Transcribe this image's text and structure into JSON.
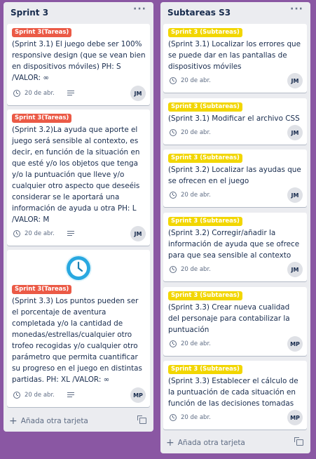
{
  "lists": [
    {
      "title": "Sprint 3",
      "menu": "···",
      "add_card": "Añada otra tarjeta",
      "cards": [
        {
          "label": "Sprint 3(Tareas)",
          "text": "(Sprint 3.1) El juego debe ser 100% responsive design (que se vean bien en dispositivos móviles) PH: S /VALOR: ∞",
          "date": "20 de abr.",
          "member": "JM"
        },
        {
          "label": "Sprint 3(Tareas)",
          "text": "(Sprint 3.2)La ayuda que aporte el juego será sensible al contexto, es decir, en función de la situación en que esté y/o los objetos que tenga y/o la puntuación que lleve y/o cualquier otro aspecto que deseéis considerar se le aportará una información de ayuda u otra PH: L /VALOR: M",
          "date": "20 de abr.",
          "member": "JM"
        },
        {
          "label": "Sprint 3(Tareas)",
          "text": "(Sprint 3.3) Los puntos pueden ser el porcentaje de aventura completada y/o la cantidad de monedas/estrellas/cualquier otro trofeo recogidas y/o cualquier otro parámetro que permita cuantificar su progreso en el juego en distintas partidas. PH: XL /VALOR: ∞",
          "date": "20 de abr.",
          "member": "MP",
          "cover_icon": "clock-cover-icon"
        }
      ]
    },
    {
      "title": "Subtareas S3",
      "menu": "···",
      "add_card": "Añada otra tarjeta",
      "cards": [
        {
          "label": "Sprint 3 (Subtareas)",
          "text": "(Sprint 3.1) Localizar los errores que se puede dar en las pantallas de dispositivos móviles",
          "date": "20 de abr.",
          "member": "JM"
        },
        {
          "label": "Sprint 3 (Subtareas)",
          "text": "(Sprint 3.1) Modificar el archivo CSS",
          "date": "20 de abr.",
          "member": "JM"
        },
        {
          "label": "Sprint 3 (Subtareas)",
          "text": "(Sprint 3.2) Localizar las ayudas que se ofrecen en el juego",
          "date": "20 de abr.",
          "member": "JM"
        },
        {
          "label": "Sprint 3 (Subtareas)",
          "text": "(Sprint 3.2) Corregir/añadir la información de ayuda que se ofrece para que sea sensible al contexto",
          "date": "20 de abr.",
          "member": "JM"
        },
        {
          "label": "Sprint 3 (Subtareas)",
          "text": "(Sprint 3.3) Crear nueva cualidad del personaje para contabilizar la puntuación",
          "date": "20 de abr.",
          "member": "MP"
        },
        {
          "label": "Sprint 3 (Subtareas)",
          "text": "(Sprint 3.3) Establecer el cálculo de la puntuación de cada situación en función de las decisiones tomadas",
          "date": "20 de abr.",
          "member": "MP"
        }
      ]
    }
  ],
  "colors": {
    "board_bg": "#8a57a3",
    "label_red": "#eb5a46",
    "label_yellow": "#f2d600",
    "list_bg": "#ebecf0"
  }
}
